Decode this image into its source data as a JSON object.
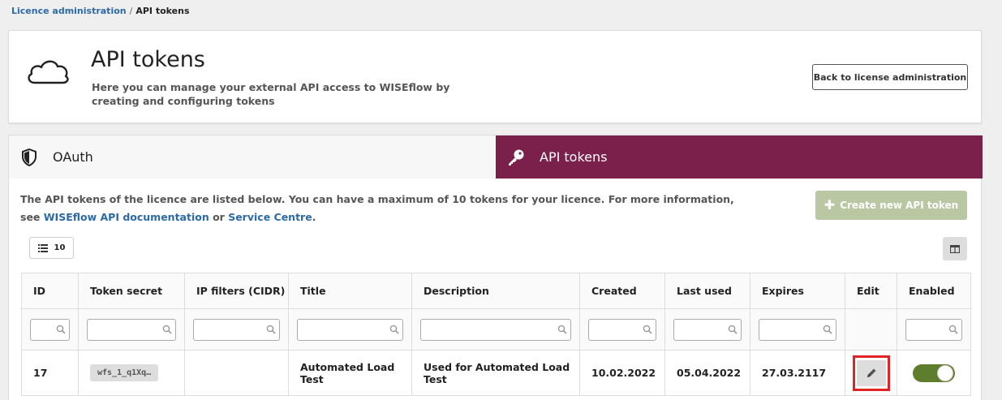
{
  "breadcrumb": {
    "parent": "Licence administration",
    "separator": "/",
    "current": "API tokens"
  },
  "header": {
    "title": "API tokens",
    "subtitle": "Here you can manage your external API access to WISEflow by creating and configuring tokens",
    "back_button": "Back to license administration",
    "icon": "cloud-icon"
  },
  "tabs": [
    {
      "label": "OAuth",
      "icon": "shield-icon",
      "active": false
    },
    {
      "label": "API tokens",
      "icon": "key-icon",
      "active": true
    }
  ],
  "intro": {
    "text_before": "The API tokens of the licence are listed below. You can have a maximum of 10 tokens for your licence. For more information, see ",
    "link1": "WISEflow API documentation",
    "text_middle": " or ",
    "link2": "Service Centre",
    "text_after": "."
  },
  "create_button": "Create new API token",
  "page_size": "10",
  "table": {
    "columns": [
      "ID",
      "Token secret",
      "IP filters (CIDR)",
      "Title",
      "Description",
      "Created",
      "Last used",
      "Expires",
      "Edit",
      "Enabled"
    ],
    "rows": [
      {
        "id": "17",
        "token_secret": "wfs_1_q1Xq…",
        "ip_filters": "",
        "title": "Automated Load Test",
        "description": "Used for Automated Load Test",
        "created": "10.02.2022",
        "last_used": "05.04.2022",
        "expires": "27.03.2117",
        "enabled": true
      }
    ]
  },
  "colors": {
    "accent": "#7b1f4b",
    "link": "#2b6aa8",
    "toggle_on": "#5f7e2d",
    "create_disabled": "#b9c7a3",
    "highlight": "#e02424"
  }
}
